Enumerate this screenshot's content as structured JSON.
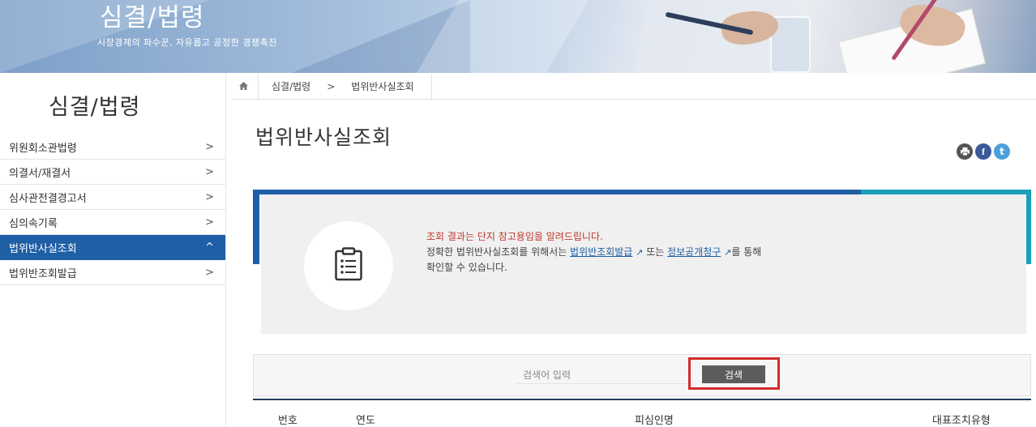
{
  "banner": {
    "title": "심결/법령",
    "subtitle": "시장경제의 파수꾼, 자유롭고 공정한 경쟁촉진"
  },
  "sidebar": {
    "title": "심결/법령",
    "items": [
      {
        "label": "위원회소관법령",
        "chevron": ">",
        "active": false
      },
      {
        "label": "의결서/재결서",
        "chevron": ">",
        "active": false
      },
      {
        "label": "심사관전결경고서",
        "chevron": ">",
        "active": false
      },
      {
        "label": "심의속기록",
        "chevron": ">",
        "active": false
      },
      {
        "label": "법위반사실조회",
        "chevron": "^",
        "active": true
      },
      {
        "label": "법위반조회발급",
        "chevron": ">",
        "active": false
      }
    ]
  },
  "breadcrumb": {
    "home_icon": "home-icon",
    "items": [
      "심결/법령",
      "법위반사실조회"
    ],
    "separator": ">"
  },
  "page": {
    "title": "법위반사실조회"
  },
  "share": {
    "print_icon": "print-icon",
    "facebook_icon": "facebook-icon",
    "facebook_glyph": "f",
    "twitter_icon": "twitter-icon",
    "twitter_glyph": "t"
  },
  "notice": {
    "icon": "clipboard-icon",
    "line1": "조회 결과는 단지 참고용임을 알려드립니다.",
    "line2_prefix": "정확한 법위반사실조회를 위해서는 ",
    "link1": "법위반조회발급",
    "middle": " 또는 ",
    "link2": "정보공개청구",
    "line2_suffix": "를 통해",
    "line3": "확인할 수 있습니다.",
    "external_glyph": "↗"
  },
  "search": {
    "placeholder": "검색어 입력",
    "button_label": "검색"
  },
  "table": {
    "columns": [
      "번호",
      "연도",
      "피심인명",
      "대표조치유형"
    ]
  },
  "colors": {
    "primary_blue": "#1e5fa5",
    "teal": "#19a0b8",
    "highlight_red": "#d42b2b",
    "notice_red": "#c0392b"
  }
}
